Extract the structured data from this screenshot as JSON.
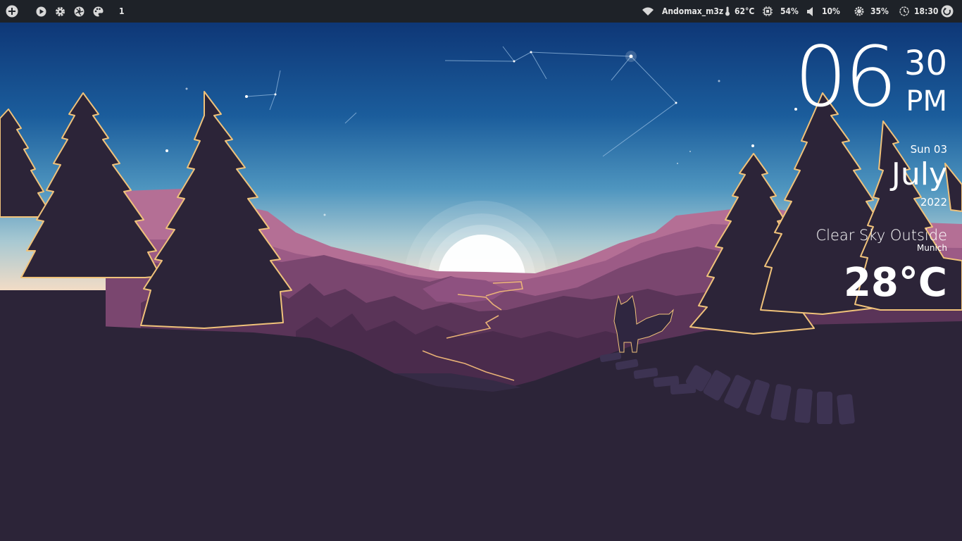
{
  "topbar": {
    "left_icons": [
      "add-circle-icon",
      "play-circle-icon",
      "gear-icon",
      "aperture-icon",
      "palette-icon"
    ],
    "workspace": "1",
    "wifi": {
      "icon": "wifi-icon",
      "label": "Andomax_m3z"
    },
    "temperature": {
      "icon": "thermometer-icon",
      "label": "62°C"
    },
    "cpu": {
      "icon": "cpu-icon",
      "label": "54%"
    },
    "volume": {
      "icon": "speaker-icon",
      "label": "10%"
    },
    "brightness": {
      "icon": "brightness-icon",
      "label": "35%"
    },
    "clock": {
      "icon": "clock-icon",
      "label": "18:30"
    },
    "power_icon": "power-icon"
  },
  "widget": {
    "hour": "06",
    "minute": "30",
    "ampm": "PM",
    "day": "Sun 03",
    "month": "July",
    "year": "2022",
    "condition": "Clear Sky Outside",
    "city": "Munich",
    "temperature": "28°C"
  },
  "colors": {
    "bar_bg": "#1e2228",
    "sky_top": "#0f3a7a",
    "sky_horizon": "#e9d3c4",
    "mountains": "#b06a92",
    "ground": "#2c2438",
    "tree_rim": "#f0c27a"
  }
}
